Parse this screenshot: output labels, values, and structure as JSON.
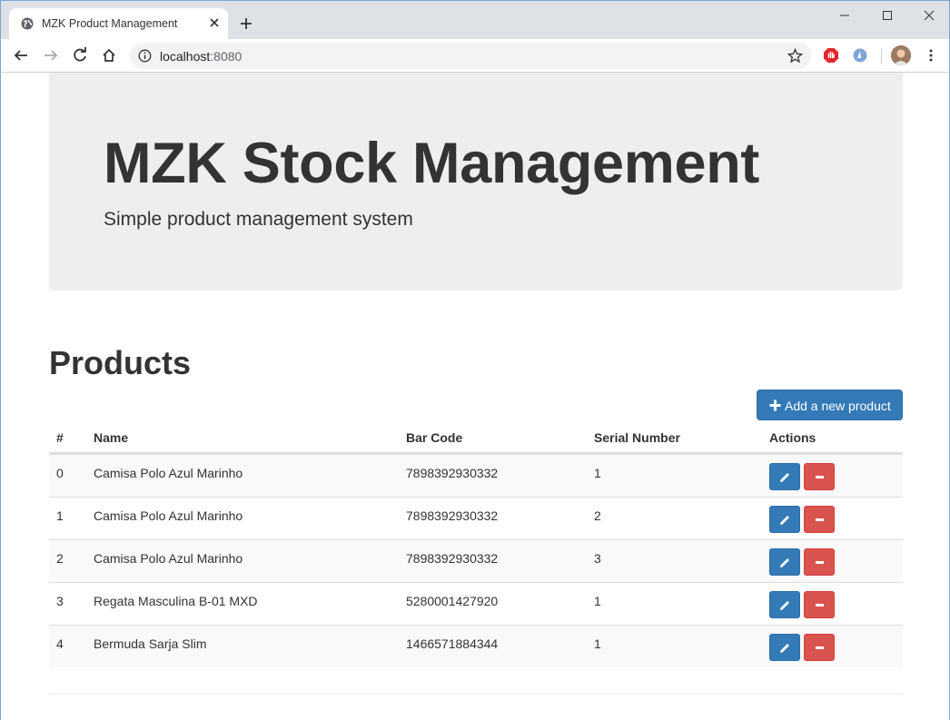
{
  "browser": {
    "tab_title": "MZK Product Management",
    "url_host": "localhost",
    "url_port": ":8080"
  },
  "jumbotron": {
    "title": "MZK Stock Management",
    "subtitle": "Simple product management system"
  },
  "products": {
    "heading": "Products",
    "add_button_label": "Add a new product",
    "columns": [
      "#",
      "Name",
      "Bar Code",
      "Serial Number",
      "Actions"
    ],
    "rows": [
      {
        "index": "0",
        "name": "Camisa Polo Azul Marinho",
        "barcode": "7898392930332",
        "serial": "1"
      },
      {
        "index": "1",
        "name": "Camisa Polo Azul Marinho",
        "barcode": "7898392930332",
        "serial": "2"
      },
      {
        "index": "2",
        "name": "Camisa Polo Azul Marinho",
        "barcode": "7898392930332",
        "serial": "3"
      },
      {
        "index": "3",
        "name": "Regata Masculina B-01 MXD",
        "barcode": "5280001427920",
        "serial": "1"
      },
      {
        "index": "4",
        "name": "Bermuda Sarja Slim",
        "barcode": "1466571884344",
        "serial": "1"
      }
    ]
  },
  "colors": {
    "primary": "#337ab7",
    "danger": "#d9534f",
    "jumbotron_bg": "#eeeeee"
  }
}
